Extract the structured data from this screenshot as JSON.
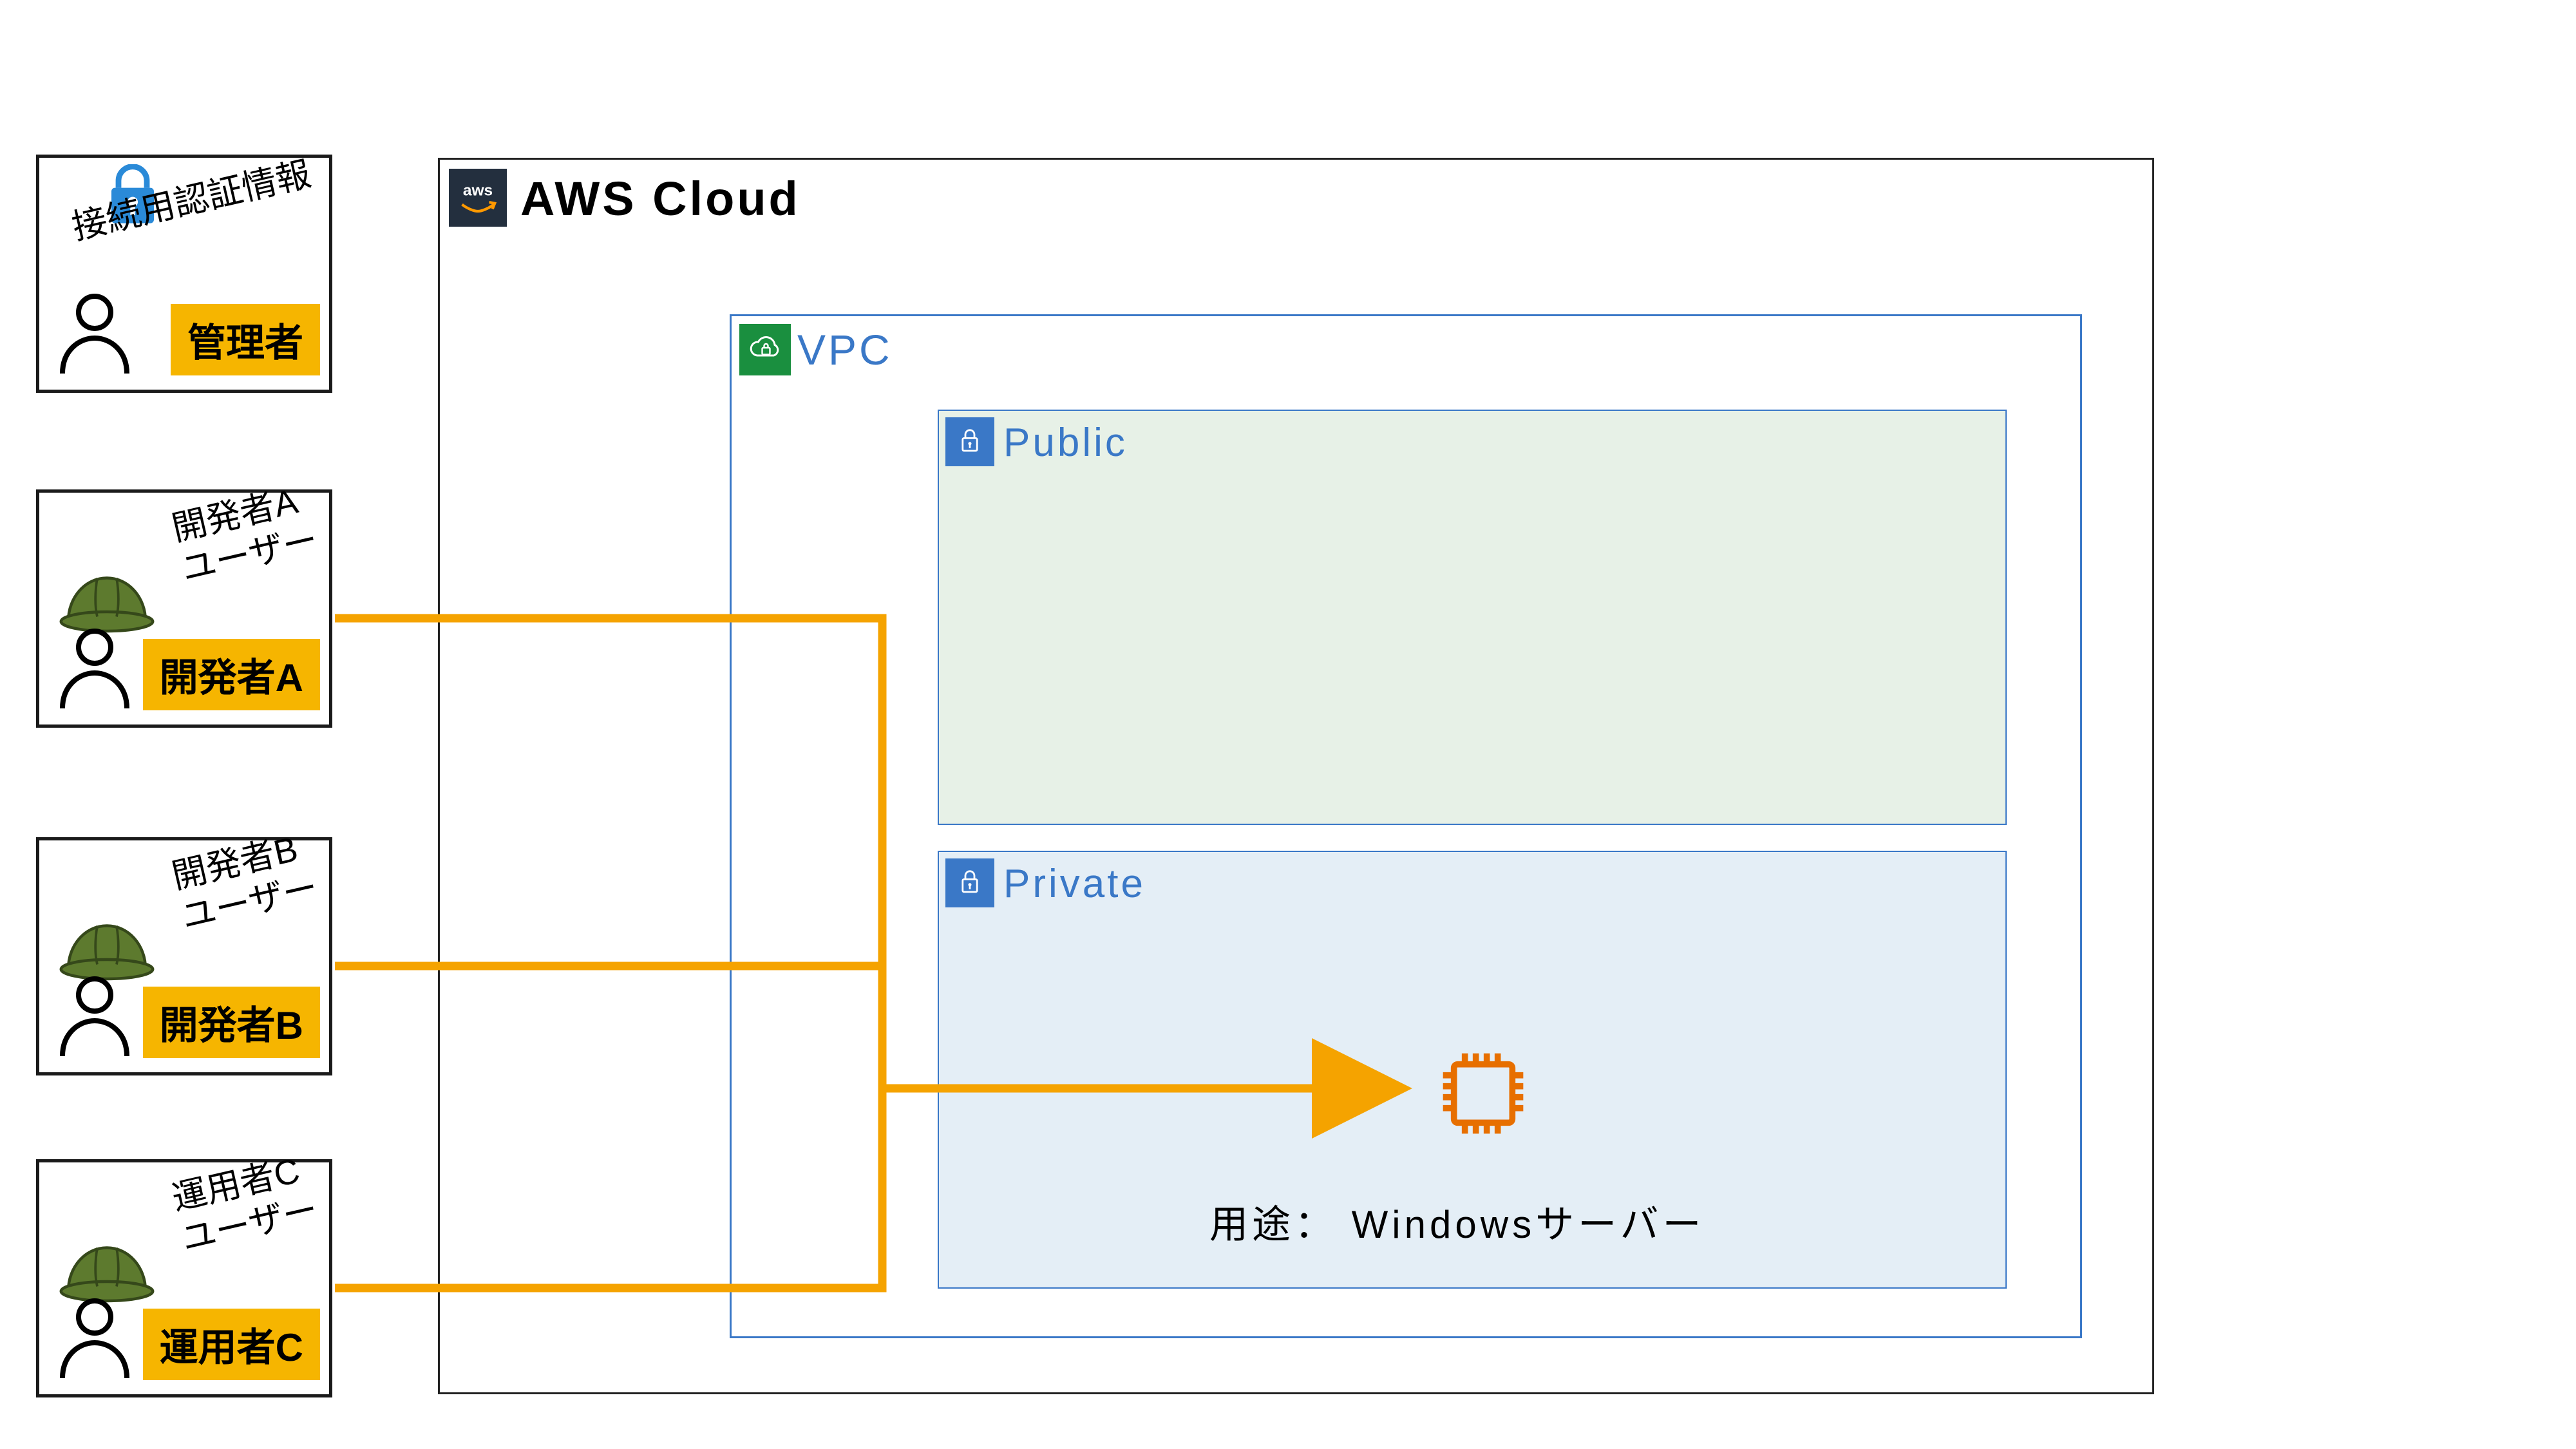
{
  "users": {
    "admin": {
      "tilt_text": "接続用認証情報",
      "badge": "管理者"
    },
    "devA": {
      "tilt_line1": "開発者A",
      "tilt_line2": "ユーザー",
      "badge": "開発者A"
    },
    "devB": {
      "tilt_line1": "開発者B",
      "tilt_line2": "ユーザー",
      "badge": "開発者B"
    },
    "opC": {
      "tilt_line1": "運用者C",
      "tilt_line2": "ユーザー",
      "badge": "運用者C"
    }
  },
  "cloud": {
    "title": "AWS Cloud",
    "logo_text": "aws"
  },
  "vpc": {
    "title": "VPC"
  },
  "subnets": {
    "public": {
      "title": "Public"
    },
    "private": {
      "title": "Private"
    }
  },
  "server": {
    "caption": "用途： Windowsサーバー"
  },
  "colors": {
    "orange": "#f5a300",
    "blue": "#3a78c7",
    "green": "#1a8f3f",
    "ec2": "#e76f00"
  }
}
